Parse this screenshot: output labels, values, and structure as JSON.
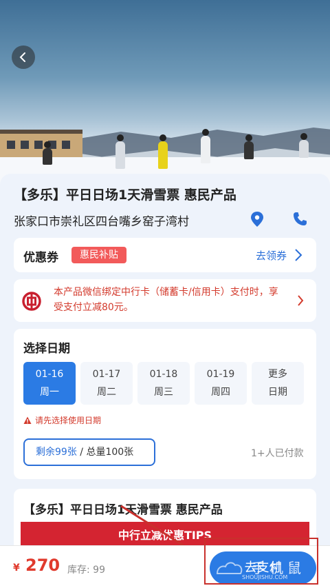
{
  "product": {
    "title": "【多乐】平日日场1天滑雪票 惠民产品",
    "address": "张家口市崇礼区四台嘴乡窑子湾村"
  },
  "coupon": {
    "label": "优惠券",
    "tag": "惠民补贴",
    "action": "去领券"
  },
  "promo": {
    "text": "本产品微信绑定中行卡（储蓄卡/信用卡）支付时，享受支付立减80元。"
  },
  "dates": {
    "heading": "选择日期",
    "options": [
      {
        "date": "01-16",
        "weekday": "周一"
      },
      {
        "date": "01-17",
        "weekday": "周二"
      },
      {
        "date": "01-18",
        "weekday": "周三"
      },
      {
        "date": "01-19",
        "weekday": "周四"
      },
      {
        "date": "更多",
        "weekday": "日期"
      }
    ],
    "warning": "请先选择使用日期",
    "remaining": "剩余99张",
    "total": " / 总量100张",
    "paid": "1+人已付款"
  },
  "detail": {
    "title": "【多乐】平日日场1天滑雪票 惠民产品",
    "banner": "中行立减优惠TIPS"
  },
  "bottom_bar": {
    "currency": "¥",
    "price": "270",
    "stock": "库存:  99",
    "pay_label": "去支付"
  },
  "watermark": {
    "main": "手机鼠",
    "sub": "SHOUJISHU.COM"
  },
  "colors": {
    "accent": "#2b7be4",
    "price": "#e03a2d",
    "promo": "#d33a2c"
  }
}
